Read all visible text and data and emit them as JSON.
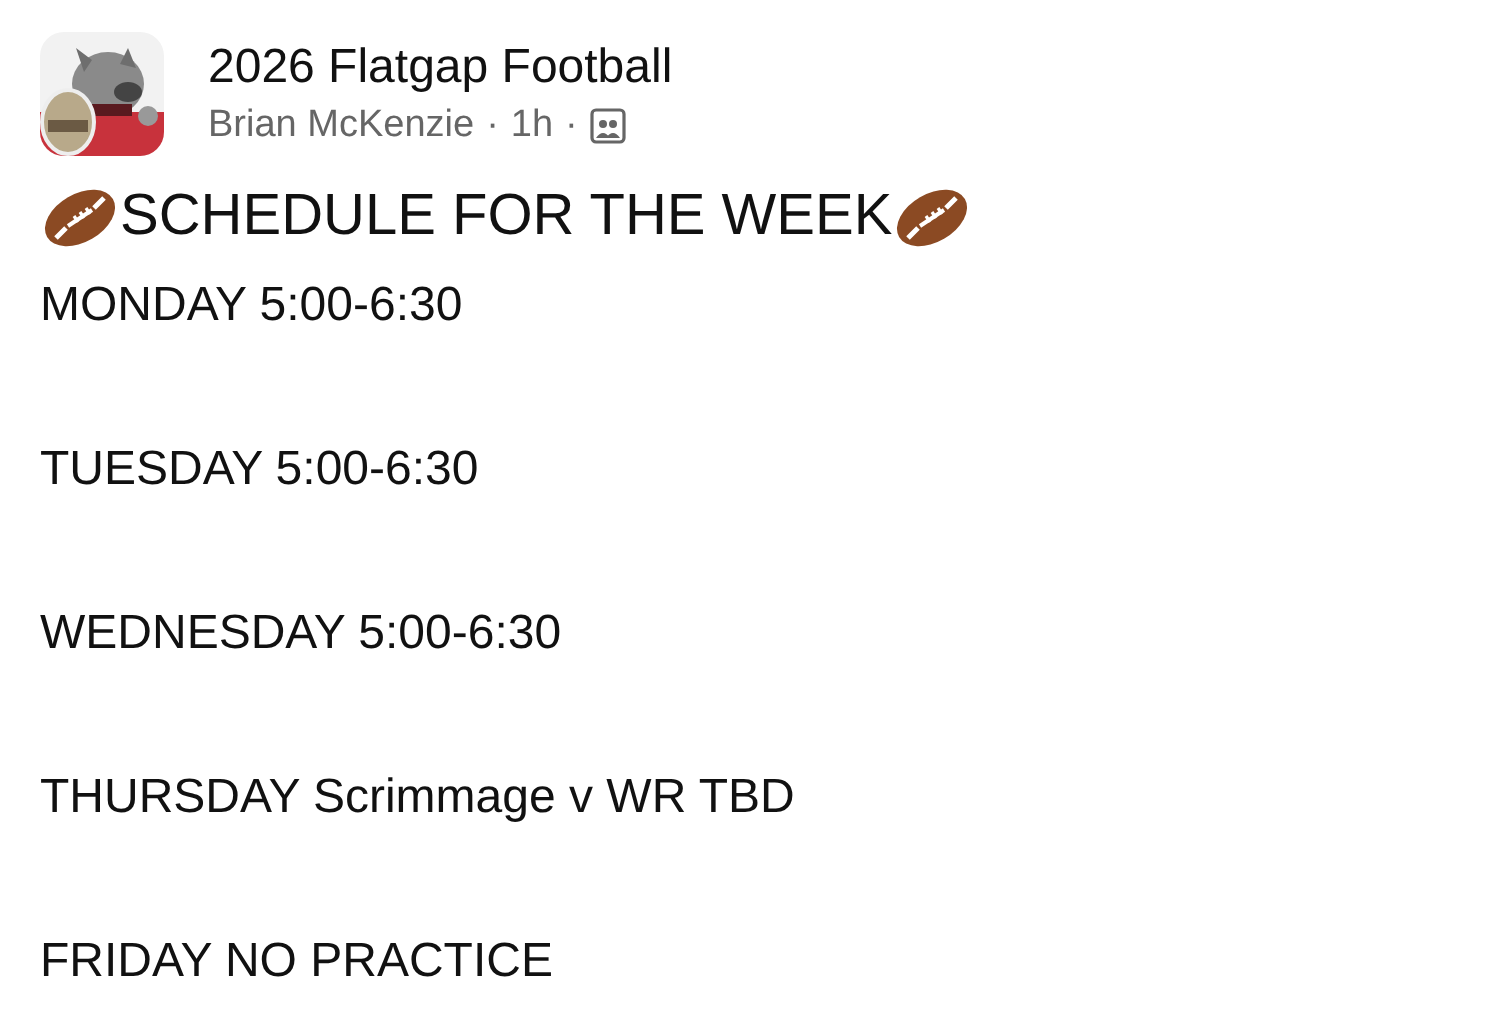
{
  "group": {
    "name": "2026 Flatgap Football"
  },
  "post": {
    "author": "Brian McKenzie",
    "separator_1": "·",
    "time": "1h",
    "separator_2": "·",
    "heading": "SCHEDULE FOR THE WEEK",
    "lines": [
      "MONDAY 5:00-6:30",
      "TUESDAY 5:00-6:30",
      "WEDNESDAY 5:00-6:30",
      "THURSDAY Scrimmage v WR TBD",
      "FRIDAY NO PRACTICE"
    ]
  }
}
